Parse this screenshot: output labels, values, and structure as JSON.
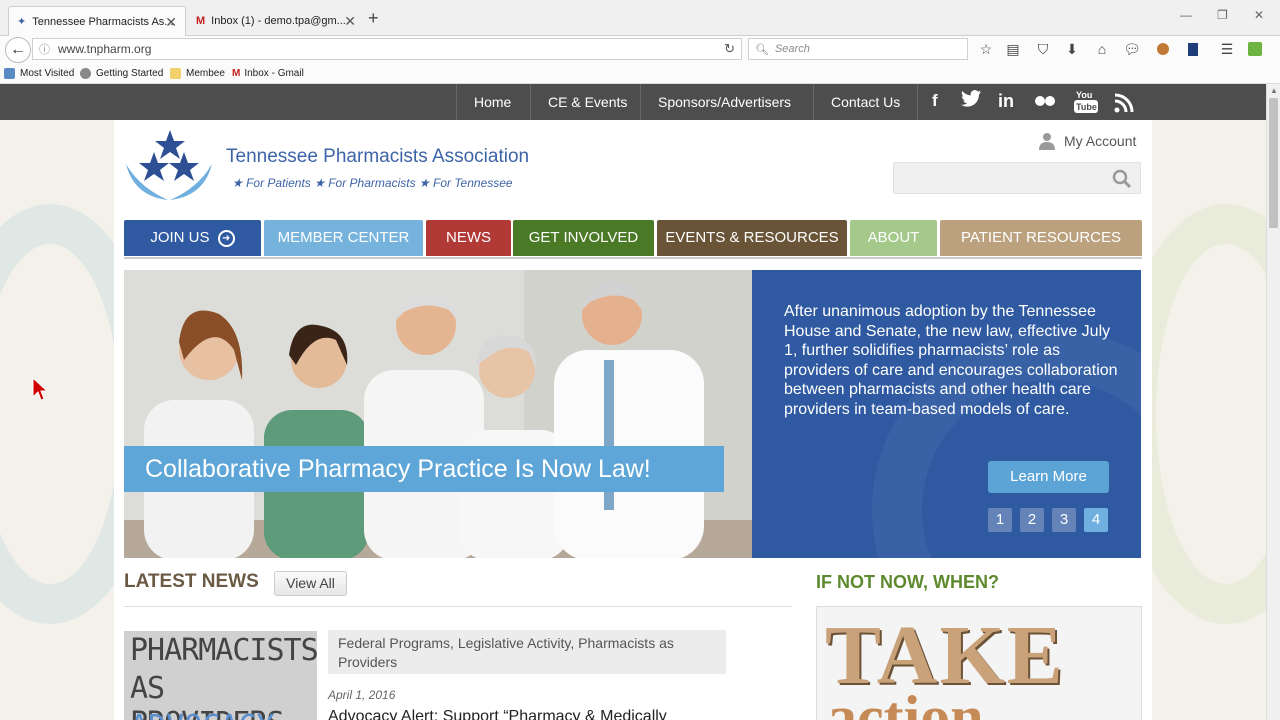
{
  "browser": {
    "tabs": [
      {
        "title": "Tennessee Pharmacists As...",
        "active": true
      },
      {
        "title": "Inbox (1) - demo.tpa@gm...",
        "active": false
      }
    ],
    "url": "www.tnpharm.org",
    "search_placeholder": "Search",
    "bookmarks": [
      "Most Visited",
      "Getting Started",
      "Membee",
      "Inbox - Gmail"
    ]
  },
  "topnav": {
    "items": [
      "Home",
      "CE & Events",
      "Sponsors/Advertisers",
      "Contact Us"
    ],
    "social_icons": [
      "facebook-icon",
      "twitter-icon",
      "linkedin-icon",
      "flickr-icon",
      "youtube-icon",
      "rss-icon"
    ]
  },
  "header": {
    "org_name": "Tennessee Pharmacists Association",
    "tagline": "★ For Patients ★ For Pharmacists ★ For Tennessee",
    "account_label": "My Account"
  },
  "mainnav": {
    "items": [
      {
        "label": "JOIN US",
        "color": "#2f5aa2"
      },
      {
        "label": "MEMBER CENTER",
        "color": "#75b3dd"
      },
      {
        "label": "NEWS",
        "color": "#b13a36"
      },
      {
        "label": "GET INVOLVED",
        "color": "#4a7a26"
      },
      {
        "label": "EVENTS & RESOURCES",
        "color": "#6a5437"
      },
      {
        "label": "ABOUT",
        "color": "#a4c98a"
      },
      {
        "label": "PATIENT RESOURCES",
        "color": "#bba17d"
      }
    ]
  },
  "banner": {
    "headline": "Collaborative Pharmacy Practice Is Now Law!",
    "body": "After unanimous adoption by the Tennessee House and Senate, the new law, effective July 1, further solidifies pharmacists’ role as providers of care and encourages collaboration between pharmacists and other health care providers in team-based models of care.",
    "button": "Learn More",
    "pages": [
      "1",
      "2",
      "3",
      "4"
    ],
    "active_page": "4"
  },
  "news": {
    "title": "LATEST NEWS",
    "view_all": "View All",
    "thumb_line1": "PHARMACISTS",
    "thumb_line2": "AS PROVIDERS",
    "thumb_line3": "ADVOCACY",
    "categories": "Federal Programs, Legislative Activity, Pharmacists as Providers",
    "date": "April 1, 2016",
    "headline": "Advocacy Alert: Support “Pharmacy & Medically"
  },
  "sidebar": {
    "title": "IF NOT NOW, WHEN?",
    "img_word1": "TAKE",
    "img_word2": "action"
  }
}
